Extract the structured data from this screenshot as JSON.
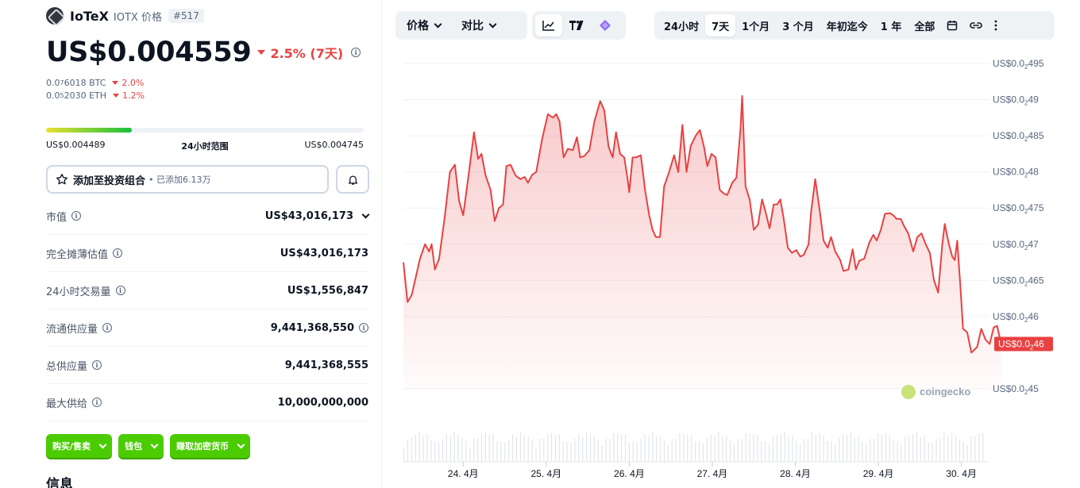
{
  "coin": {
    "name": "IoTeX",
    "symbol_label": "IOTX 价格",
    "rank": "#517"
  },
  "price": {
    "value": "US$0.004559",
    "change_7d": "2.5% (7天)"
  },
  "btc": {
    "value_a": "0.0",
    "value_sub": "7",
    "value_b": "6018 BTC",
    "change": "2.0%"
  },
  "eth": {
    "value_a": "0.0",
    "value_sub": "5",
    "value_b": "2030 ETH",
    "change": "1.2%"
  },
  "range": {
    "low": "US$0.004489",
    "label": "24小时范围",
    "high": "US$0.004745",
    "fill_fraction": 0.27
  },
  "actions": {
    "portfolio_label": "添加至投资组合",
    "portfolio_sub": "• 已添加6.13万"
  },
  "stats": [
    {
      "label": "市值",
      "value": "US$43,016,173"
    },
    {
      "label": "完全摊薄估值",
      "value": "US$43,016,173"
    },
    {
      "label": "24小时交易量",
      "value": "US$1,556,847"
    },
    {
      "label": "流通供应量",
      "value": "9,441,368,550"
    },
    {
      "label": "总供应量",
      "value": "9,441,368,555"
    },
    {
      "label": "最大供给",
      "value": "10,000,000,000"
    }
  ],
  "green_buttons": [
    "购买/售卖",
    "钱包",
    "赚取加密货币"
  ],
  "info_title": "信息",
  "toolbar": {
    "price_dropdown": "价格",
    "compare_dropdown": "对比",
    "ranges": [
      "24小时",
      "7天",
      "1个月",
      "3 个月",
      "年初迄今",
      "1 年",
      "全部"
    ],
    "selected_range": "7天"
  },
  "colors": {
    "up": "#4bcc00",
    "down": "#e84142",
    "text": "#0d1421",
    "muted": "#58667e"
  },
  "icons": [
    "star-icon",
    "bell-icon",
    "info-icon",
    "line-chart-icon",
    "tradingview-icon",
    "diamond-icon",
    "calendar-icon",
    "link-icon",
    "more-icon"
  ],
  "chart_data": {
    "type": "line",
    "y_ticks": [
      {
        "v": 0.00495,
        "a": "US$0.0",
        "s": "2",
        "b": "495"
      },
      {
        "v": 0.0049,
        "a": "US$0.0",
        "s": "2",
        "b": "49"
      },
      {
        "v": 0.00485,
        "a": "US$0.0",
        "s": "2",
        "b": "485"
      },
      {
        "v": 0.0048,
        "a": "US$0.0",
        "s": "2",
        "b": "48"
      },
      {
        "v": 0.00475,
        "a": "US$0.0",
        "s": "2",
        "b": "475"
      },
      {
        "v": 0.0047,
        "a": "US$0.0",
        "s": "2",
        "b": "47"
      },
      {
        "v": 0.00465,
        "a": "US$0.0",
        "s": "2",
        "b": "465"
      },
      {
        "v": 0.0046,
        "a": "US$0.0",
        "s": "2",
        "b": "46"
      },
      {
        "v": 0.0045,
        "a": "US$0.0",
        "s": "2",
        "b": "45"
      }
    ],
    "ylim": [
      0.0045,
      0.00495
    ],
    "x_ticks": [
      "24. 4月",
      "25. 4月",
      "26. 4月",
      "27. 4月",
      "28. 4月",
      "29. 4月",
      "30. 4月"
    ],
    "x_tick_pos": [
      1,
      2,
      3,
      4,
      5,
      6,
      7
    ],
    "x_range": [
      0.28,
      7.3
    ],
    "current_label": {
      "a": "US$0.0",
      "s": "2",
      "b": "46"
    },
    "series": [
      {
        "color": "#e84142",
        "points": [
          [
            0.28,
            0.004675
          ],
          [
            0.33,
            0.00462
          ],
          [
            0.38,
            0.00463
          ],
          [
            0.48,
            0.00468
          ],
          [
            0.54,
            0.0047
          ],
          [
            0.59,
            0.00469
          ],
          [
            0.62,
            0.0047
          ],
          [
            0.66,
            0.004665
          ],
          [
            0.71,
            0.00468
          ],
          [
            0.78,
            0.00474
          ],
          [
            0.84,
            0.0048
          ],
          [
            0.9,
            0.00481
          ],
          [
            0.95,
            0.00476
          ],
          [
            1.0,
            0.00474
          ],
          [
            1.07,
            0.0048
          ],
          [
            1.13,
            0.004855
          ],
          [
            1.18,
            0.004818
          ],
          [
            1.22,
            0.004825
          ],
          [
            1.27,
            0.004795
          ],
          [
            1.33,
            0.004775
          ],
          [
            1.38,
            0.004732
          ],
          [
            1.43,
            0.00475
          ],
          [
            1.48,
            0.004755
          ],
          [
            1.52,
            0.004808
          ],
          [
            1.57,
            0.00481
          ],
          [
            1.63,
            0.004795
          ],
          [
            1.69,
            0.00479
          ],
          [
            1.74,
            0.004793
          ],
          [
            1.78,
            0.004785
          ],
          [
            1.83,
            0.004796
          ],
          [
            1.88,
            0.0048
          ],
          [
            1.95,
            0.004845
          ],
          [
            2.02,
            0.00488
          ],
          [
            2.08,
            0.004875
          ],
          [
            2.12,
            0.00488
          ],
          [
            2.16,
            0.00487
          ],
          [
            2.21,
            0.00482
          ],
          [
            2.26,
            0.004832
          ],
          [
            2.32,
            0.00483
          ],
          [
            2.37,
            0.004848
          ],
          [
            2.41,
            0.00482
          ],
          [
            2.46,
            0.004822
          ],
          [
            2.52,
            0.00483
          ],
          [
            2.58,
            0.00487
          ],
          [
            2.65,
            0.004898
          ],
          [
            2.7,
            0.004885
          ],
          [
            2.75,
            0.004835
          ],
          [
            2.8,
            0.00482
          ],
          [
            2.84,
            0.004855
          ],
          [
            2.89,
            0.004825
          ],
          [
            2.94,
            0.00482
          ],
          [
            2.98,
            0.00479
          ],
          [
            3.0,
            0.004772
          ],
          [
            3.04,
            0.00482
          ],
          [
            3.08,
            0.00482
          ],
          [
            3.14,
            0.004823
          ],
          [
            3.19,
            0.004775
          ],
          [
            3.24,
            0.00474
          ],
          [
            3.28,
            0.00472
          ],
          [
            3.32,
            0.00471
          ],
          [
            3.37,
            0.00471
          ],
          [
            3.42,
            0.00478
          ],
          [
            3.48,
            0.0048
          ],
          [
            3.54,
            0.004823
          ],
          [
            3.59,
            0.0048
          ],
          [
            3.64,
            0.004865
          ],
          [
            3.69,
            0.0048
          ],
          [
            3.74,
            0.004836
          ],
          [
            3.8,
            0.00485
          ],
          [
            3.85,
            0.004858
          ],
          [
            3.9,
            0.004835
          ],
          [
            3.94,
            0.004808
          ],
          [
            3.99,
            0.004825
          ],
          [
            4.04,
            0.00482
          ],
          [
            4.09,
            0.004775
          ],
          [
            4.14,
            0.00477
          ],
          [
            4.18,
            0.004768
          ],
          [
            4.24,
            0.004785
          ],
          [
            4.29,
            0.004792
          ],
          [
            4.34,
            0.00486
          ],
          [
            4.36,
            0.004905
          ],
          [
            4.4,
            0.00478
          ],
          [
            4.45,
            0.004762
          ],
          [
            4.5,
            0.00472
          ],
          [
            4.55,
            0.004727
          ],
          [
            4.6,
            0.004762
          ],
          [
            4.64,
            0.004745
          ],
          [
            4.69,
            0.004722
          ],
          [
            4.74,
            0.004755
          ],
          [
            4.78,
            0.004755
          ],
          [
            4.82,
            0.004762
          ],
          [
            4.86,
            0.004735
          ],
          [
            4.91,
            0.004695
          ],
          [
            4.96,
            0.004688
          ],
          [
            5.01,
            0.004692
          ],
          [
            5.06,
            0.004683
          ],
          [
            5.1,
            0.004685
          ],
          [
            5.16,
            0.0047
          ],
          [
            5.19,
            0.004745
          ],
          [
            5.24,
            0.00479
          ],
          [
            5.29,
            0.00475
          ],
          [
            5.34,
            0.004705
          ],
          [
            5.39,
            0.004695
          ],
          [
            5.43,
            0.00471
          ],
          [
            5.48,
            0.00469
          ],
          [
            5.54,
            0.004678
          ],
          [
            5.58,
            0.004663
          ],
          [
            5.64,
            0.004665
          ],
          [
            5.69,
            0.004693
          ],
          [
            5.73,
            0.004665
          ],
          [
            5.77,
            0.004677
          ],
          [
            5.83,
            0.00468
          ],
          [
            5.89,
            0.004702
          ],
          [
            5.94,
            0.004713
          ],
          [
            5.98,
            0.004705
          ],
          [
            6.03,
            0.00472
          ],
          [
            6.08,
            0.004742
          ],
          [
            6.14,
            0.004743
          ],
          [
            6.18,
            0.00474
          ],
          [
            6.22,
            0.004735
          ],
          [
            6.27,
            0.004735
          ],
          [
            6.31,
            0.004725
          ],
          [
            6.36,
            0.004715
          ],
          [
            6.42,
            0.00469
          ],
          [
            6.47,
            0.00471
          ],
          [
            6.52,
            0.004715
          ],
          [
            6.57,
            0.0047
          ],
          [
            6.62,
            0.004688
          ],
          [
            6.67,
            0.00465
          ],
          [
            6.72,
            0.004633
          ],
          [
            6.77,
            0.0047
          ],
          [
            6.8,
            0.004728
          ],
          [
            6.85,
            0.0047
          ],
          [
            6.89,
            0.004683
          ],
          [
            6.92,
            0.004678
          ],
          [
            6.95,
            0.004705
          ],
          [
            6.99,
            0.004638
          ],
          [
            7.02,
            0.004583
          ],
          [
            7.07,
            0.004578
          ],
          [
            7.12,
            0.00455
          ],
          [
            7.19,
            0.004558
          ],
          [
            7.24,
            0.004583
          ],
          [
            7.29,
            0.004568
          ],
          [
            7.34,
            0.004562
          ],
          [
            7.39,
            0.004585
          ],
          [
            7.43,
            0.004587
          ],
          [
            7.48,
            0.004562
          ]
        ]
      }
    ]
  }
}
